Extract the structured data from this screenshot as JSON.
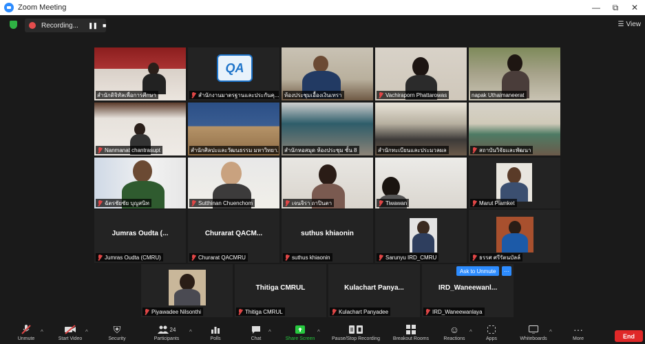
{
  "window": {
    "title": "Zoom Meeting",
    "minimize": "—",
    "restore": "⧉",
    "close": "✕"
  },
  "recording": {
    "label": "Recording...",
    "pause": "❚❚",
    "stop": "■"
  },
  "view": {
    "label": "View"
  },
  "ask_to_unmute": "Ask to Unmute",
  "ask_more": "···",
  "tiles": [
    {
      "name": "สำนักดิจิทัลเพื่อการศึกษา",
      "muted": false
    },
    {
      "name": "สำนักงานมาตรฐานและประกันคุ...",
      "muted": true
    },
    {
      "name": "ห้องประชุมเอื้องเงินเทรา",
      "muted": false
    },
    {
      "name": "Vachiraporn Phattarowas",
      "muted": true
    },
    {
      "name": "napak Uthaimaneerat",
      "muted": false
    },
    {
      "name": "Nanmanat chantrasupt",
      "muted": true
    },
    {
      "name": "สำนักศิลปะและวัฒนธรรม มหาวิทยา...",
      "muted": false
    },
    {
      "name": "สำนักหอสมุด ห้องประชุม ชั้น 8",
      "muted": false
    },
    {
      "name": "สำนักทะเบียนและประมวลผล",
      "muted": false
    },
    {
      "name": "สถาบันวิจัยและพัฒนา",
      "muted": true
    },
    {
      "name": "ฉัตรชัยชัย บุญสนิท",
      "muted": true
    },
    {
      "name": "Sutthinan Chuenchom",
      "muted": true
    },
    {
      "name": "เจนจิรา ถาปินตา",
      "muted": true
    },
    {
      "name": "Tiwawan",
      "muted": true
    },
    {
      "name": "Marut Piamket",
      "muted": true
    },
    {
      "name": "Jumras Oudta (CMRU)",
      "big": "Jumras Oudta (...",
      "muted": true
    },
    {
      "name": "Churarat QACMRU",
      "big": "Churarat QACM...",
      "muted": true
    },
    {
      "name": "suthus khiaonin",
      "big": "suthus khiaonin",
      "muted": true
    },
    {
      "name": "Sarunyu IRD_CMRU",
      "muted": true
    },
    {
      "name": "ธรรศ ศรีรัตนบัลล์",
      "muted": true
    },
    {
      "name": "Piyawadee Nilsonthi",
      "muted": true
    },
    {
      "name": "Thitiga CMRUL",
      "big": "Thitiga CMRUL",
      "muted": true
    },
    {
      "name": "Kulachart Panyadee",
      "big": "Kulachart Panya...",
      "muted": true
    },
    {
      "name": "IRD_Waneewanlaya",
      "big": "IRD_Waneewanl...",
      "muted": true
    }
  ],
  "toolbar": {
    "unmute": "Unmute",
    "start_video": "Start Video",
    "security": "Security",
    "participants": "Participants",
    "participants_count": "24",
    "polls": "Polls",
    "chat": "Chat",
    "share_screen": "Share Screen",
    "pause_stop_recording": "Pause/Stop Recording",
    "breakout_rooms": "Breakout Rooms",
    "reactions": "Reactions",
    "apps": "Apps",
    "whiteboards": "Whiteboards",
    "more": "More",
    "end": "End"
  },
  "colors": {
    "accent": "#2d8cff",
    "end": "#e02828",
    "active_speaker": "#c8e26a",
    "muted_icon": "#e04646"
  }
}
